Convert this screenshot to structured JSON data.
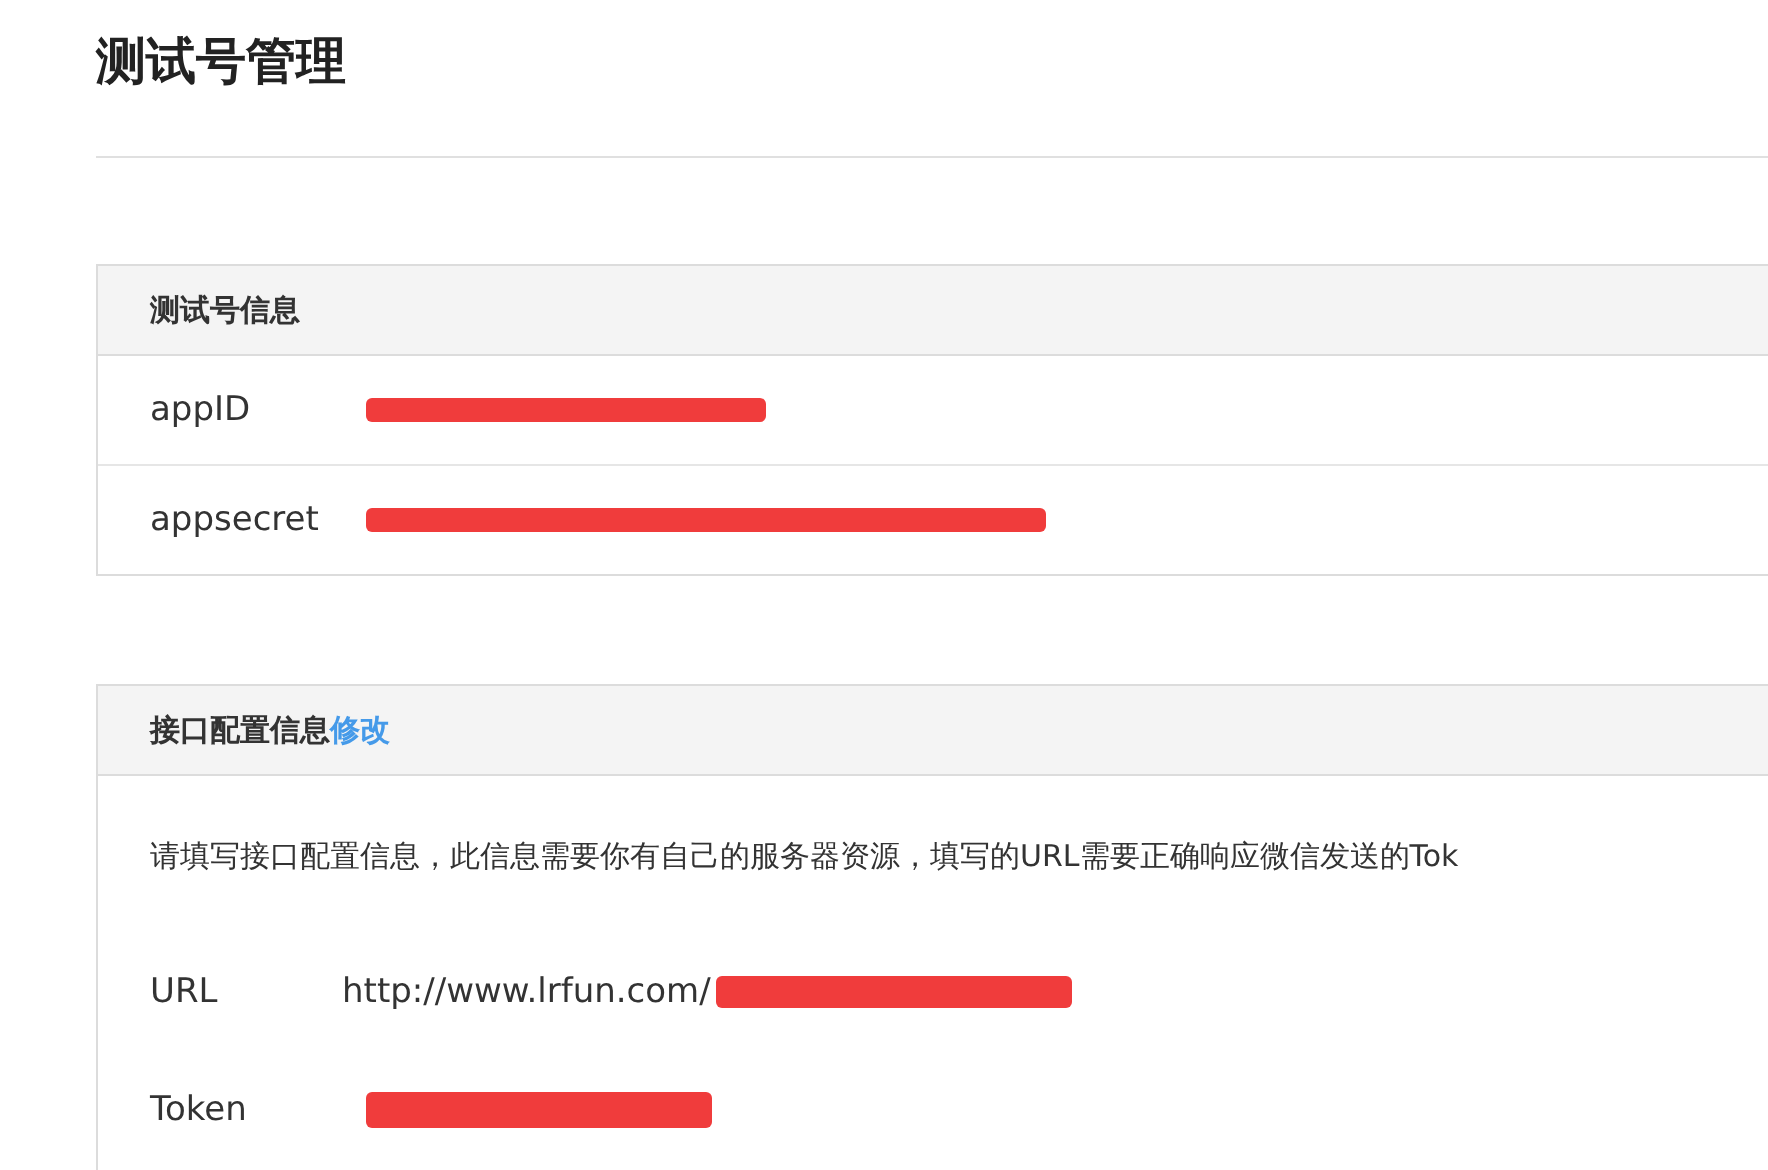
{
  "page_title": "测试号管理",
  "sections": [
    {
      "title": "测试号信息",
      "fields": [
        {
          "label": "appID",
          "redacted": true
        },
        {
          "label": "appsecret",
          "redacted": true
        }
      ]
    },
    {
      "title": "接口配置信息",
      "edit_link": "修改",
      "intro": "请填写接口配置信息，此信息需要你有自己的服务器资源，填写的URL需要正确响应微信发送的Tok",
      "fields": [
        {
          "label": "URL",
          "value": "http://www.lrfun.com/",
          "redacted": true
        },
        {
          "label": "Token",
          "redacted": true
        }
      ]
    }
  ]
}
